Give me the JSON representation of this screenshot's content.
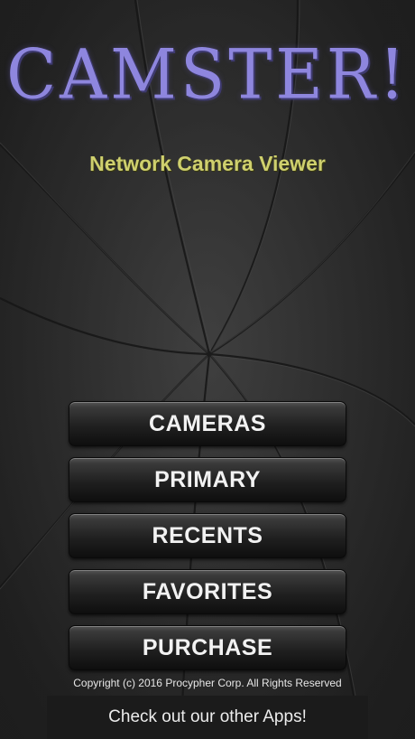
{
  "app": {
    "logo_text": "CAMSTER!",
    "subtitle": "Network Camera Viewer"
  },
  "menu": {
    "cameras": "CAMERAS",
    "primary": "PRIMARY",
    "recents": "RECENTS",
    "favorites": "FAVORITES",
    "purchase": "PURCHASE"
  },
  "footer": {
    "copyright": "Copyright (c) 2016 Procypher Corp. All Rights Reserved",
    "other_apps": "Check out our other Apps!"
  },
  "colors": {
    "logo": "#8e86de",
    "subtitle": "#cfd06e",
    "background": "#2c2c2c"
  }
}
